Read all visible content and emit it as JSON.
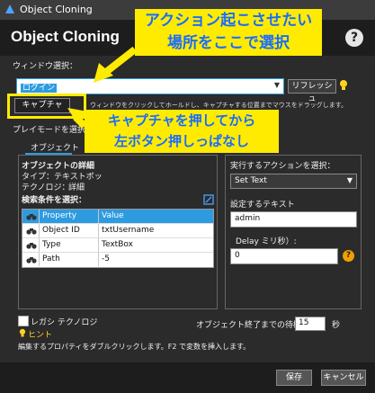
{
  "window": {
    "title": "Object Cloning"
  },
  "header": {
    "title": "Object Cloning",
    "help_icon": "help-icon"
  },
  "window_select": {
    "label": "ウィンドウ選択：",
    "dropdown_value": "ログイン",
    "refresh_label": "リフレッシュ",
    "capture_label": "キャプチャ",
    "hint_text": "ウィンドウをクリックしてホールドし、キャプチャする位置までマウスをドラッグします。",
    "playmode_label": "プレイモードを選択："
  },
  "callouts": {
    "top": [
      "アクション起こさせたい",
      "場所をここで選択"
    ],
    "bottom": [
      "キャプチャを押してから",
      "左ボタン押しっぱなし"
    ]
  },
  "object_tab": {
    "tab_label": "オブジェクト",
    "details_title": "オブジェクトの詳細",
    "type_label": "タイプ：テキストボッ",
    "tech_label": "テクノロジ：",
    "tech_value": "詳細",
    "search_label": "検索条件を選択：",
    "columns": [
      "Property",
      "Value"
    ],
    "rows": [
      {
        "icon": "binoculars-icon",
        "property": "Property",
        "value": "Value",
        "selected": true
      },
      {
        "icon": "binoculars-icon",
        "property": "Object ID",
        "value": "txtUsername",
        "selected": false
      },
      {
        "icon": "binoculars-icon",
        "property": "Type",
        "value": "TextBox",
        "selected": false
      },
      {
        "icon": "binoculars-icon",
        "property": "Path",
        "value": "-5",
        "selected": false
      }
    ]
  },
  "action_panel": {
    "action_label": "実行するアクションを選択：",
    "action_value": "Set Text",
    "text_label": "設定するテキスト",
    "text_value": "admin",
    "delay_label": "Delay ミリ秒）:",
    "delay_value": "0"
  },
  "footer": {
    "legacy_label": "レガシ テクノロジ",
    "hint_label": "ヒント",
    "timeout_label": "オブジェクト終了までの待機時間",
    "timeout_value": "15",
    "timeout_unit": "秒",
    "help_text": "編集するプロパティをダブルクリックします。F2 で変数を挿入します。",
    "save_label": "保存",
    "cancel_label": "キャンセル"
  },
  "colors": {
    "accent": "#2e9be0",
    "callout_bg": "#ffeb00",
    "callout_text": "#1a6cff",
    "arrow": "#ffeb00"
  }
}
